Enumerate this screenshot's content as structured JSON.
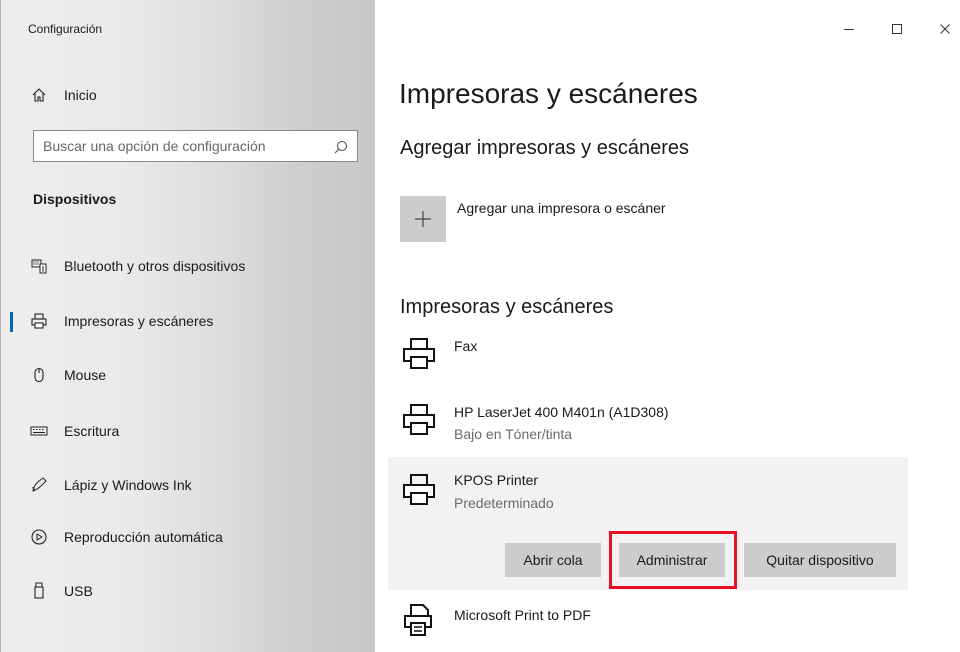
{
  "window": {
    "title": "Configuración",
    "controls": {
      "minimize": "—",
      "maximize": "☐",
      "close": "✕"
    }
  },
  "sidebar": {
    "home_label": "Inicio",
    "search_placeholder": "Buscar una opción de configuración",
    "section_label": "Dispositivos",
    "items": [
      {
        "label": "Bluetooth y otros dispositivos",
        "icon": "bluetooth-devices-icon"
      },
      {
        "label": "Impresoras y escáneres",
        "icon": "printer-icon",
        "selected": true
      },
      {
        "label": "Mouse",
        "icon": "mouse-icon"
      },
      {
        "label": "Escritura",
        "icon": "keyboard-icon"
      },
      {
        "label": "Lápiz y Windows Ink",
        "icon": "pen-icon"
      },
      {
        "label": "Reproducción automática",
        "icon": "autoplay-icon"
      },
      {
        "label": "USB",
        "icon": "usb-icon"
      }
    ],
    "accent_color": "#0067c0"
  },
  "main": {
    "title": "Impresoras y escáneres",
    "add_section_title": "Agregar impresoras y escáneres",
    "add_button_label": "Agregar una impresora o escáner",
    "list_title": "Impresoras y escáneres",
    "printers": [
      {
        "name": "Fax",
        "status": ""
      },
      {
        "name": "HP LaserJet 400 M401n (A1D308)",
        "status": "Bajo en Tóner/tinta"
      },
      {
        "name": "KPOS Printer",
        "status": "Predeterminado",
        "expanded": true
      },
      {
        "name": "Microsoft Print to PDF",
        "status": ""
      }
    ],
    "actions": {
      "open_queue": "Abrir cola",
      "manage": "Administrar",
      "remove": "Quitar dispositivo"
    },
    "highlight_color": "#e81123"
  }
}
